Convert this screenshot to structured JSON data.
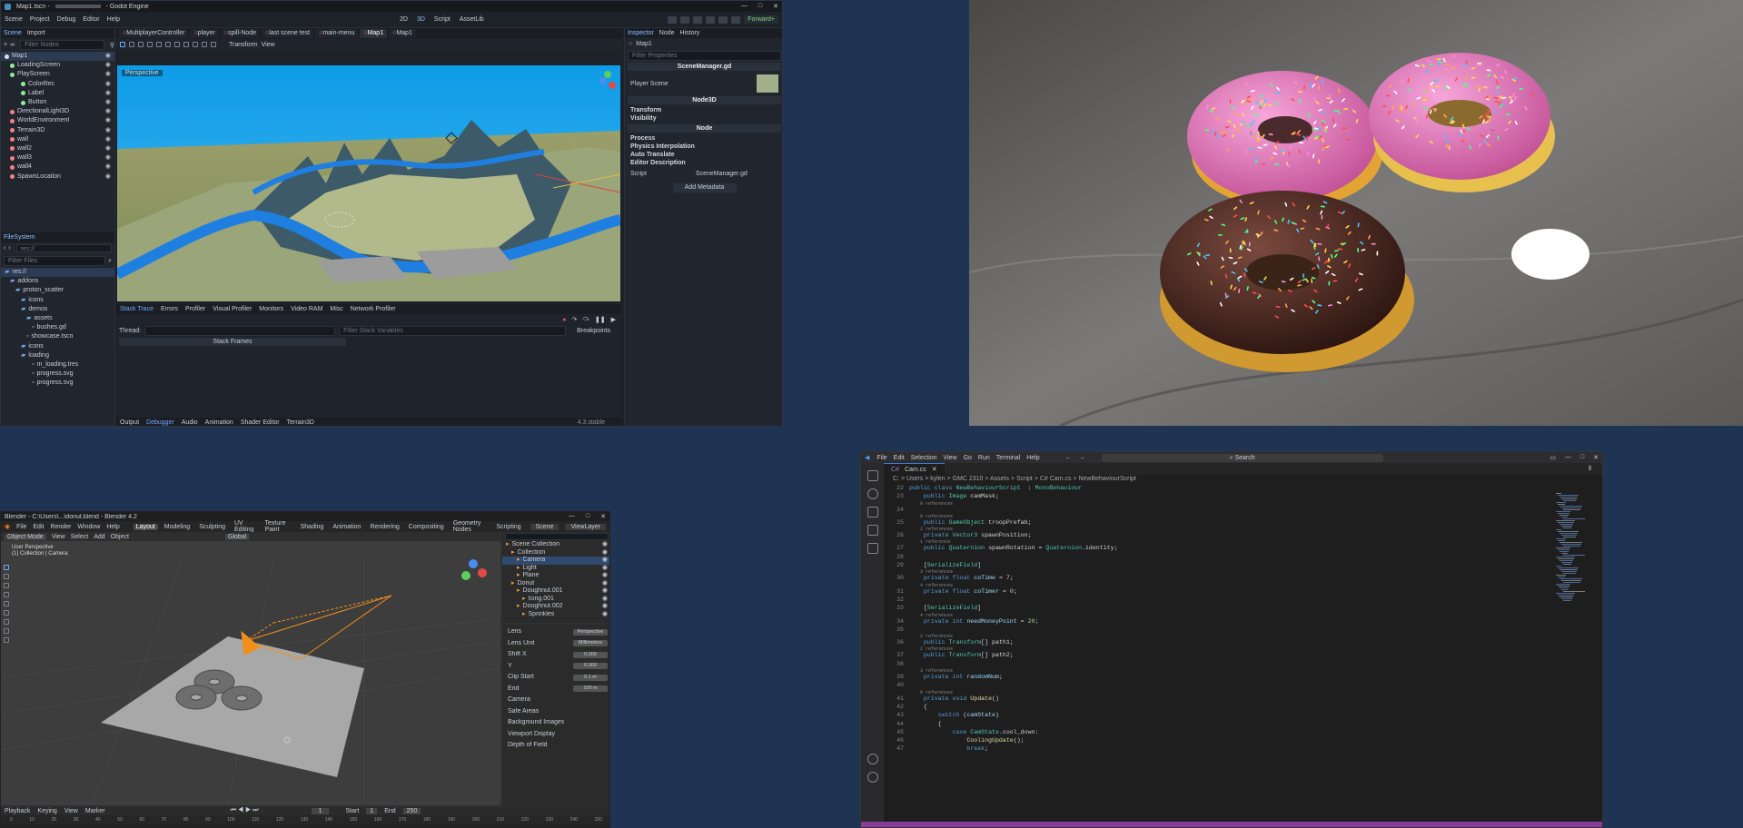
{
  "godot": {
    "title": "Map1.tscn - ",
    "title_suffix": "- Godot Engine",
    "menu": [
      "Scene",
      "Project",
      "Debug",
      "Editor",
      "Help"
    ],
    "modes": [
      "2D",
      "3D",
      "Script",
      "AssetLib"
    ],
    "renderer": "Forward+",
    "scene_dock_tabs": [
      "Scene",
      "Import"
    ],
    "filter_nodes": "Filter Nodes",
    "tree": [
      {
        "label": "Map1",
        "color": "#e0e0e0",
        "ind": 4,
        "sel": true
      },
      {
        "label": "LoadingScreen",
        "color": "#8eef97",
        "ind": 10
      },
      {
        "label": "PlayScreen",
        "color": "#8eef97",
        "ind": 10
      },
      {
        "label": "ColorRec",
        "color": "#8eef97",
        "ind": 22
      },
      {
        "label": "Label",
        "color": "#8eef97",
        "ind": 22
      },
      {
        "label": "Button",
        "color": "#8eef97",
        "ind": 22
      },
      {
        "label": "DirectionalLight3D",
        "color": "#fc7f7f",
        "ind": 10
      },
      {
        "label": "WorldEnvironment",
        "color": "#fc7f7f",
        "ind": 10
      },
      {
        "label": "Terrain3D",
        "color": "#fc7f7f",
        "ind": 10
      },
      {
        "label": "wall",
        "color": "#fc7f7f",
        "ind": 10
      },
      {
        "label": "wall2",
        "color": "#fc7f7f",
        "ind": 10
      },
      {
        "label": "wall3",
        "color": "#fc7f7f",
        "ind": 10
      },
      {
        "label": "wall4",
        "color": "#fc7f7f",
        "ind": 10
      },
      {
        "label": "SpawnLocation",
        "color": "#fc7f7f",
        "ind": 10
      }
    ],
    "fs_title": "FileSystem",
    "filter_files": "Filter Files",
    "fs": [
      {
        "label": "res://",
        "ind": 4
      },
      {
        "label": "addons",
        "ind": 10
      },
      {
        "label": "proton_scatter",
        "ind": 16
      },
      {
        "label": "icons",
        "ind": 22
      },
      {
        "label": "demos",
        "ind": 22
      },
      {
        "label": "assets",
        "ind": 28
      },
      {
        "label": "bushes.gd",
        "ind": 34,
        "file": true
      },
      {
        "label": "showcase.tscn",
        "ind": 28,
        "file": true
      },
      {
        "label": "icons",
        "ind": 22
      },
      {
        "label": "loading",
        "ind": 22
      },
      {
        "label": "m_loading.tres",
        "ind": 34,
        "file": true
      },
      {
        "label": "progress.svg",
        "ind": 34,
        "file": true
      },
      {
        "label": "progress.svg",
        "ind": 34,
        "file": true
      }
    ],
    "scene_tabs": [
      {
        "label": "MultiplayerController",
        "active": false
      },
      {
        "label": "player",
        "active": false
      },
      {
        "label": "spill-Node",
        "active": false
      },
      {
        "label": "last scene test",
        "active": false
      },
      {
        "label": "main-menu",
        "active": false
      },
      {
        "label": "Map1",
        "active": true
      },
      {
        "label": "Map1",
        "active": false
      }
    ],
    "toolbar_transform": "Transform",
    "toolbar_view": "View",
    "viewport_label": "Perspective",
    "debug_tabs": [
      "Stack Trace",
      "Errors",
      "Profiler",
      "Visual Profiler",
      "Monitors",
      "Video RAM",
      "Misc",
      "Network Profiler"
    ],
    "thread_label": "Thread:",
    "filter_stack": "Filter Stack Variables",
    "stack_frames": "Stack Frames",
    "breakpoints": "Breakpoints",
    "bottom_tabs": [
      "Output",
      "Debugger",
      "Audio",
      "Animation",
      "Shader Editor",
      "Terrain3D"
    ],
    "bottom_active": "Debugger",
    "version": "4.3.stable",
    "inspector_tabs": [
      "Inspector",
      "Node",
      "History"
    ],
    "node_name": "Map1",
    "filter_props": "Filter Properties",
    "script_name": "SceneManager.gd",
    "player_scene_label": "Player Scene",
    "node3d_label": "Node3D",
    "node3d_props": [
      "Transform",
      "Visibility"
    ],
    "node_label": "Node",
    "node_props": [
      "Process",
      "Physics Interpolation",
      "Auto Translate",
      "Editor Description"
    ],
    "script_label": "Script",
    "script_value": "SceneManager.gd",
    "add_metadata": "Add Metadata"
  },
  "donut": {},
  "blender": {
    "title": "Blender - C:\\Users\\...\\donut.blend - Blender 4.2",
    "menu": [
      "File",
      "Edit",
      "Render",
      "Window",
      "Help"
    ],
    "workspaces": [
      "Layout",
      "Modeling",
      "Sculpting",
      "UV Editing",
      "Texture Paint",
      "Shading",
      "Animation",
      "Rendering",
      "Compositing",
      "Geometry Nodes",
      "Scripting"
    ],
    "active_ws": "Layout",
    "view_menu": [
      "Object Mode",
      "View",
      "Select",
      "Add",
      "Object"
    ],
    "global": "Global",
    "overlay1": "User Perspective",
    "overlay2": "(1) Collection | Camera",
    "scene": "Scene",
    "view_layer": "ViewLayer",
    "outliner": [
      {
        "label": "Scene Collection",
        "ind": 4
      },
      {
        "label": "Collection",
        "ind": 10
      },
      {
        "label": "Camera",
        "ind": 16,
        "sel": true
      },
      {
        "label": "Light",
        "ind": 16
      },
      {
        "label": "Plane",
        "ind": 16
      },
      {
        "label": "Donut",
        "ind": 10
      },
      {
        "label": "Doughnut.001",
        "ind": 16
      },
      {
        "label": "Icing.001",
        "ind": 22
      },
      {
        "label": "Doughnut.002",
        "ind": 16
      },
      {
        "label": "Sprinkles",
        "ind": 22
      }
    ],
    "props": [
      {
        "label": "Lens",
        "value": "Perspective"
      },
      {
        "label": "Lens Unit",
        "value": "Millimeters"
      },
      {
        "label": "Shift X",
        "value": "0.000"
      },
      {
        "label": "Y",
        "value": "0.000"
      },
      {
        "label": "Clip Start",
        "value": "0.1 m"
      },
      {
        "label": "End",
        "value": "100 m"
      },
      {
        "label": "Camera",
        "value": ""
      },
      {
        "label": "Safe Areas",
        "value": ""
      },
      {
        "label": "Background Images",
        "value": ""
      },
      {
        "label": "Viewport Display",
        "value": ""
      },
      {
        "label": "Depth of Field",
        "value": ""
      }
    ],
    "timeline_menu": [
      "Playback",
      "Keying",
      "View",
      "Marker"
    ],
    "start_label": "Start",
    "start": "1",
    "end_label": "End",
    "end": "250",
    "frame": "1",
    "ticks": [
      "0",
      "10",
      "20",
      "30",
      "40",
      "50",
      "60",
      "70",
      "80",
      "90",
      "100",
      "110",
      "120",
      "130",
      "140",
      "150",
      "160",
      "170",
      "180",
      "190",
      "200",
      "210",
      "220",
      "230",
      "240",
      "250"
    ]
  },
  "vscode": {
    "menu": [
      "File",
      "Edit",
      "Selection",
      "View",
      "Go",
      "Run",
      "Terminal",
      "Help"
    ],
    "search": "Search",
    "tab": "Cam.cs",
    "breadcrumb": "C: > Users > kylen > GMC 2310 > Assets > Script > C# Cam.cs > NewBehaviourScript",
    "lines": [
      {
        "n": "22",
        "parts": [
          [
            "kw",
            "public class "
          ],
          [
            "ty",
            "NewBehaviourScript"
          ],
          [
            "",
            "  : "
          ],
          [
            "ty",
            "MonoBehaviour"
          ]
        ]
      },
      {
        "n": "23",
        "parts": [
          [
            "kw",
            "    public "
          ],
          [
            "ty",
            "Image"
          ],
          [
            "",
            " camMask;"
          ]
        ]
      },
      {
        "n": "",
        "parts": [
          [
            "ref",
            "    0 references"
          ]
        ]
      },
      {
        "n": "24",
        "parts": [
          [
            "",
            ""
          ]
        ]
      },
      {
        "n": "",
        "parts": [
          [
            "ref",
            "    0 references"
          ]
        ]
      },
      {
        "n": "25",
        "parts": [
          [
            "kw",
            "    public "
          ],
          [
            "ty",
            "GameObject"
          ],
          [
            "",
            " troopPrefab;"
          ]
        ]
      },
      {
        "n": "",
        "parts": [
          [
            "ref",
            "    2 references"
          ]
        ]
      },
      {
        "n": "26",
        "parts": [
          [
            "kw",
            "    private "
          ],
          [
            "ty",
            "Vector3"
          ],
          [
            "",
            " spawnPosition;"
          ]
        ]
      },
      {
        "n": "",
        "parts": [
          [
            "ref",
            "    1 reference"
          ]
        ]
      },
      {
        "n": "27",
        "parts": [
          [
            "kw",
            "    public "
          ],
          [
            "ty",
            "Quaternion"
          ],
          [
            "",
            " spawnRotation = "
          ],
          [
            "ty",
            "Quaternion"
          ],
          [
            "",
            ".identity;"
          ]
        ]
      },
      {
        "n": "28",
        "parts": [
          [
            "",
            ""
          ]
        ]
      },
      {
        "n": "29",
        "parts": [
          [
            "",
            "    ["
          ],
          [
            "at",
            "SerializeField"
          ],
          [
            "",
            "]"
          ]
        ]
      },
      {
        "n": "",
        "parts": [
          [
            "ref",
            "    3 references"
          ]
        ]
      },
      {
        "n": "30",
        "parts": [
          [
            "kw",
            "    private float "
          ],
          [
            "vr",
            "coTime"
          ],
          [
            "",
            " = "
          ],
          [
            "nu",
            "7"
          ],
          [
            "",
            ";"
          ]
        ]
      },
      {
        "n": "",
        "parts": [
          [
            "ref",
            "    4 references"
          ]
        ]
      },
      {
        "n": "31",
        "parts": [
          [
            "kw",
            "    private float "
          ],
          [
            "vr",
            "coTimer"
          ],
          [
            "",
            " = "
          ],
          [
            "nu",
            "0"
          ],
          [
            "",
            ";"
          ]
        ]
      },
      {
        "n": "32",
        "parts": [
          [
            "",
            ""
          ]
        ]
      },
      {
        "n": "33",
        "parts": [
          [
            "",
            "    ["
          ],
          [
            "at",
            "SerializeField"
          ],
          [
            "",
            "]"
          ]
        ]
      },
      {
        "n": "",
        "parts": [
          [
            "ref",
            "    4 references"
          ]
        ]
      },
      {
        "n": "34",
        "parts": [
          [
            "kw",
            "    private int "
          ],
          [
            "vr",
            "needMoneyPoint"
          ],
          [
            "",
            " = "
          ],
          [
            "nu",
            "20"
          ],
          [
            "",
            ";"
          ]
        ]
      },
      {
        "n": "35",
        "parts": [
          [
            "",
            ""
          ]
        ]
      },
      {
        "n": "",
        "parts": [
          [
            "ref",
            "    2 references"
          ]
        ]
      },
      {
        "n": "36",
        "parts": [
          [
            "kw",
            "    public "
          ],
          [
            "ty",
            "Transform"
          ],
          [
            "",
            "[] path1;"
          ]
        ]
      },
      {
        "n": "",
        "parts": [
          [
            "ref",
            "    2 references"
          ]
        ]
      },
      {
        "n": "37",
        "parts": [
          [
            "kw",
            "    public "
          ],
          [
            "ty",
            "Transform"
          ],
          [
            "",
            "[] path2;"
          ]
        ]
      },
      {
        "n": "38",
        "parts": [
          [
            "",
            ""
          ]
        ]
      },
      {
        "n": "",
        "parts": [
          [
            "ref",
            "    3 references"
          ]
        ]
      },
      {
        "n": "39",
        "parts": [
          [
            "kw",
            "    private int "
          ],
          [
            "vr",
            "randomNum"
          ],
          [
            "",
            ";"
          ]
        ]
      },
      {
        "n": "40",
        "parts": [
          [
            "",
            ""
          ]
        ]
      },
      {
        "n": "",
        "parts": [
          [
            "ref",
            "    0 references"
          ]
        ]
      },
      {
        "n": "41",
        "parts": [
          [
            "kw",
            "    private void "
          ],
          [
            "fn",
            "Update"
          ],
          [
            "",
            "()"
          ]
        ]
      },
      {
        "n": "42",
        "parts": [
          [
            "",
            "    {"
          ]
        ]
      },
      {
        "n": "43",
        "parts": [
          [
            "kw",
            "        switch "
          ],
          [
            "",
            "("
          ],
          [
            "vr",
            "camState"
          ],
          [
            "",
            ")"
          ]
        ]
      },
      {
        "n": "44",
        "parts": [
          [
            "",
            "        {"
          ]
        ]
      },
      {
        "n": "45",
        "parts": [
          [
            "kw",
            "            case "
          ],
          [
            "ty",
            "CamState"
          ],
          [
            "",
            ".cool_down:"
          ]
        ]
      },
      {
        "n": "46",
        "parts": [
          [
            "",
            "                "
          ],
          [
            "fn",
            "CoolingUpdate"
          ],
          [
            "",
            "();"
          ]
        ]
      },
      {
        "n": "47",
        "parts": [
          [
            "kw",
            "                break"
          ],
          [
            "",
            ";"
          ]
        ]
      }
    ]
  }
}
